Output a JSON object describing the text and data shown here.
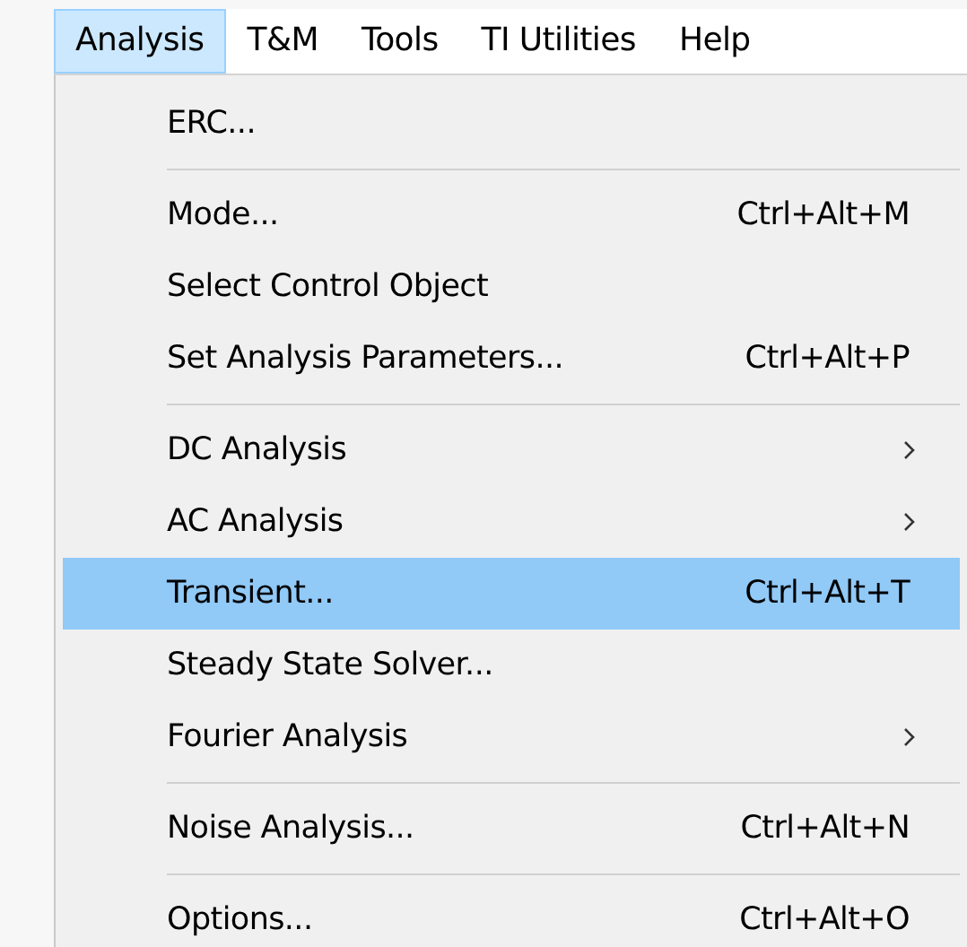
{
  "menubar": [
    {
      "label": "Analysis",
      "selected": true
    },
    {
      "label": "T&M",
      "selected": false
    },
    {
      "label": "Tools",
      "selected": false
    },
    {
      "label": "TI Utilities",
      "selected": false
    },
    {
      "label": "Help",
      "selected": false
    }
  ],
  "menu": {
    "items": [
      {
        "kind": "item",
        "label": "ERC...",
        "selected": false
      },
      {
        "kind": "separator"
      },
      {
        "kind": "item",
        "label": "Mode...",
        "shortcut": "Ctrl+Alt+M",
        "selected": false
      },
      {
        "kind": "item",
        "label": "Select Control Object",
        "selected": false
      },
      {
        "kind": "item",
        "label": "Set Analysis Parameters...",
        "shortcut": "Ctrl+Alt+P",
        "selected": false
      },
      {
        "kind": "separator"
      },
      {
        "kind": "item",
        "label": "DC Analysis",
        "submenu": true,
        "selected": false
      },
      {
        "kind": "item",
        "label": "AC Analysis",
        "submenu": true,
        "selected": false
      },
      {
        "kind": "item",
        "label": "Transient...",
        "shortcut": "Ctrl+Alt+T",
        "selected": true
      },
      {
        "kind": "item",
        "label": "Steady State Solver...",
        "selected": false
      },
      {
        "kind": "item",
        "label": "Fourier Analysis",
        "submenu": true,
        "selected": false
      },
      {
        "kind": "separator"
      },
      {
        "kind": "item",
        "label": "Noise Analysis...",
        "shortcut": "Ctrl+Alt+N",
        "selected": false
      },
      {
        "kind": "separator"
      },
      {
        "kind": "item",
        "label": "Options...",
        "shortcut": "Ctrl+Alt+O",
        "selected": false
      }
    ]
  }
}
